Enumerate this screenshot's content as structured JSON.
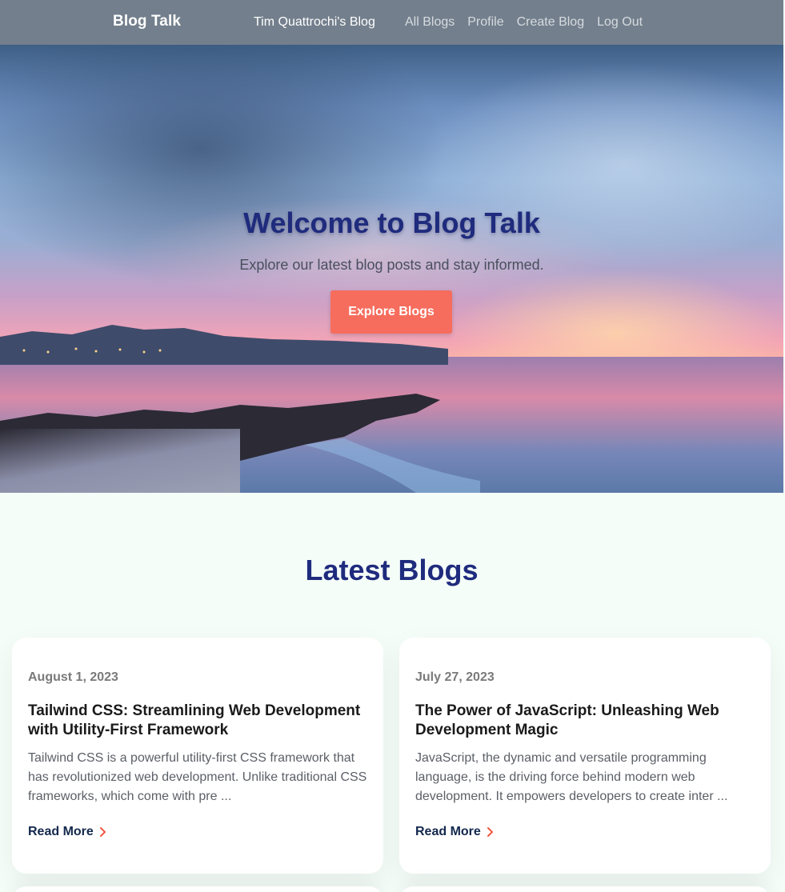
{
  "nav": {
    "brand": "Blog Talk",
    "blog_name": "Tim Quattrochi's Blog",
    "links": [
      "All Blogs",
      "Profile",
      "Create Blog",
      "Log Out"
    ]
  },
  "hero": {
    "title": "Welcome to Blog Talk",
    "subtitle": "Explore our latest blog posts and stay informed.",
    "button": "Explore Blogs"
  },
  "latest": {
    "heading": "Latest Blogs",
    "posts": [
      {
        "date": "August 1, 2023",
        "title": "Tailwind CSS: Streamlining Web Development with Utility-First Framework",
        "excerpt": "Tailwind CSS is a powerful utility-first CSS framework that has revolutionized web development. Unlike traditional CSS frameworks, which come with pre ...",
        "read_more": "Read More"
      },
      {
        "date": "July 27, 2023",
        "title": "The Power of JavaScript: Unleashing Web Development Magic",
        "excerpt": "JavaScript, the dynamic and versatile programming language, is the driving force behind modern web development. It empowers developers to create inter ...",
        "read_more": "Read More"
      }
    ]
  },
  "colors": {
    "nav_bg": "#737f8c",
    "accent": "#f66d5d",
    "heading": "#1f2b7d",
    "page_bg": "#f5fdf9"
  },
  "icons": {
    "read_more": "chevron-right-icon"
  }
}
